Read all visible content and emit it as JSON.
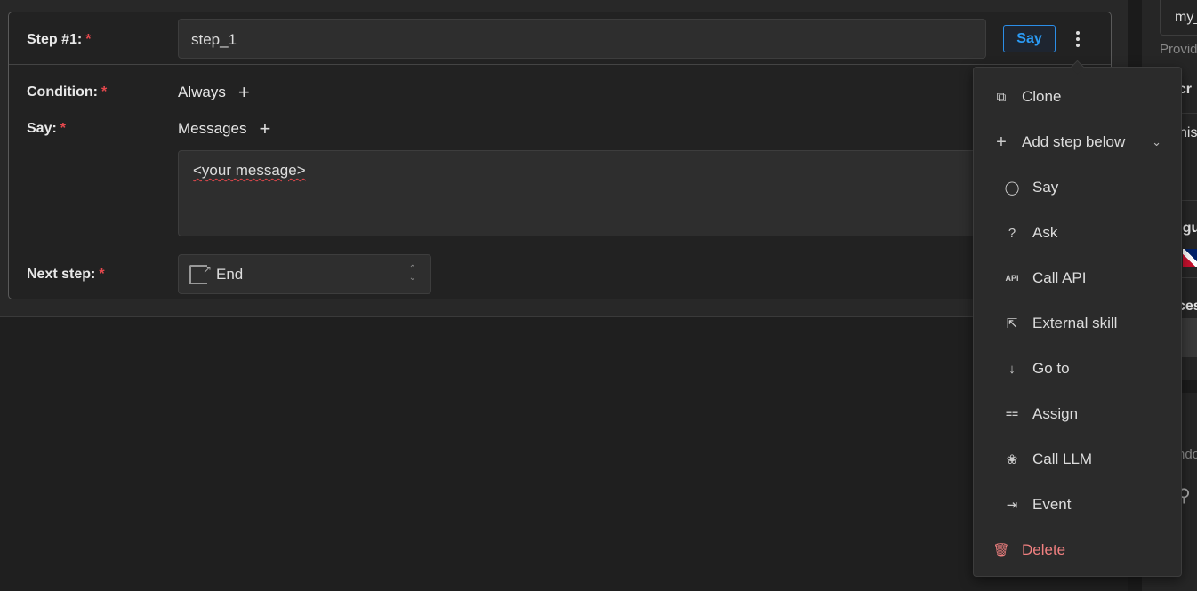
{
  "step": {
    "label": "Step #1:",
    "name_value": "step_1",
    "say_button": "Say"
  },
  "condition": {
    "label": "Condition:",
    "value": "Always"
  },
  "say": {
    "label": "Say:",
    "messages_label": "Messages",
    "message_text": "<your message>"
  },
  "next_step": {
    "label": "Next step:",
    "value": "End"
  },
  "required_mark": "*",
  "menu": {
    "clone": "Clone",
    "add_step_below": "Add step below",
    "sub_items": [
      {
        "label": "Say",
        "icon": "chat-bubble-icon"
      },
      {
        "label": "Ask",
        "icon": "question-icon"
      },
      {
        "label": "Call API",
        "icon": "api-icon"
      },
      {
        "label": "External skill",
        "icon": "external-link-icon"
      },
      {
        "label": "Go to",
        "icon": "arrow-down-icon"
      },
      {
        "label": "Assign",
        "icon": "equals-icon"
      },
      {
        "label": "Call LLM",
        "icon": "brain-icon"
      },
      {
        "label": "Event",
        "icon": "event-icon"
      }
    ],
    "delete": "Delete"
  },
  "right_panel": {
    "field_value": "my_",
    "helper": "Provid",
    "section1": "scr",
    "text1": "his",
    "section2": "ngu",
    "section3": "ces",
    "text2": "ndo"
  },
  "colors": {
    "accent": "#2b9bf5",
    "required": "#e5484d",
    "danger": "#f08080"
  }
}
